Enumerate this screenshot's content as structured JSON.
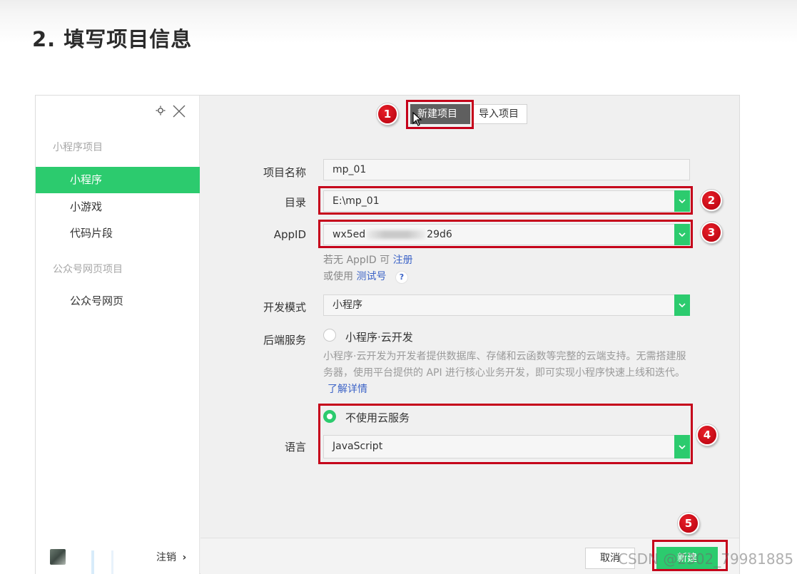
{
  "slide": {
    "title": "2. 填写项目信息"
  },
  "sidebar": {
    "group_mini": "小程序项目",
    "items_mini": [
      "小程序",
      "小游戏",
      "代码片段"
    ],
    "group_web": "公众号网页项目",
    "items_web": [
      "公众号网页"
    ],
    "logout": "注销",
    "logout_chevron": "›"
  },
  "tabs": {
    "new_project": "新建项目",
    "import_project": "导入项目"
  },
  "form": {
    "name_label": "项目名称",
    "name_value": "mp_01",
    "dir_label": "目录",
    "dir_value": "E:\\mp_01",
    "appid_label": "AppID",
    "appid_prefix": "wx5ed",
    "appid_suffix": "29d6",
    "appid_hint_prefix": "若无 AppID 可",
    "appid_hint_link": "注册",
    "test_hint_prefix": "或使用",
    "test_hint_link": "测试号",
    "help_glyph": "?",
    "mode_label": "开发模式",
    "mode_value": "小程序",
    "backend_label": "后端服务",
    "backend_option_cloud": "小程序·云开发",
    "backend_desc": "小程序·云开发为开发者提供数据库、存储和云函数等完整的云端支持。无需搭建服务器，使用平台提供的 API 进行核心业务开发，即可实现小程序快速上线和迭代。",
    "backend_desc_link": "了解详情",
    "backend_option_none": "不使用云服务",
    "lang_label": "语言",
    "lang_value": "JavaScript"
  },
  "footer": {
    "cancel": "取消",
    "create": "新建"
  },
  "annotations": [
    "1",
    "2",
    "3",
    "4",
    "5"
  ],
  "watermark": "CSDN @2302_79981885",
  "colors": {
    "accent_green": "#2ccb6e",
    "annotation_red": "#c5001a",
    "link_blue": "#3d64c7"
  }
}
